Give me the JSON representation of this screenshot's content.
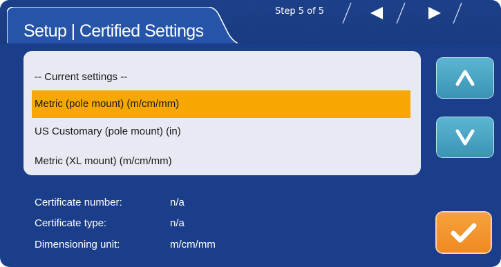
{
  "header": {
    "title": "Setup | Certified Settings",
    "step": "Step 5 of 5"
  },
  "navigation": {
    "back_icon": "triangle-left-icon",
    "forward_icon": "triangle-right-icon"
  },
  "list": {
    "items": [
      {
        "label": "-- Current settings --",
        "selected": false
      },
      {
        "label": "Metric (pole mount) (m/cm/mm)",
        "selected": true
      },
      {
        "label": "US Customary (pole mount) (in)",
        "selected": false
      },
      {
        "label": "Metric (XL mount) (m/cm/mm)",
        "selected": false
      }
    ]
  },
  "details": {
    "certificate_number": {
      "label": "Certificate number:",
      "value": "n/a"
    },
    "certificate_type": {
      "label": "Certificate type:",
      "value": "n/a"
    },
    "dimensioning_unit": {
      "label": "Dimensioning unit:",
      "value": "m/cm/mm"
    }
  },
  "buttons": {
    "scroll_up_icon": "chevron-up-icon",
    "scroll_down_icon": "chevron-down-icon",
    "confirm_icon": "checkmark-icon"
  },
  "colors": {
    "background": "#1b3e8a",
    "selection": "#f6a800",
    "accent_blue": "#4aa6c6",
    "accent_orange": "#f39a2e"
  }
}
